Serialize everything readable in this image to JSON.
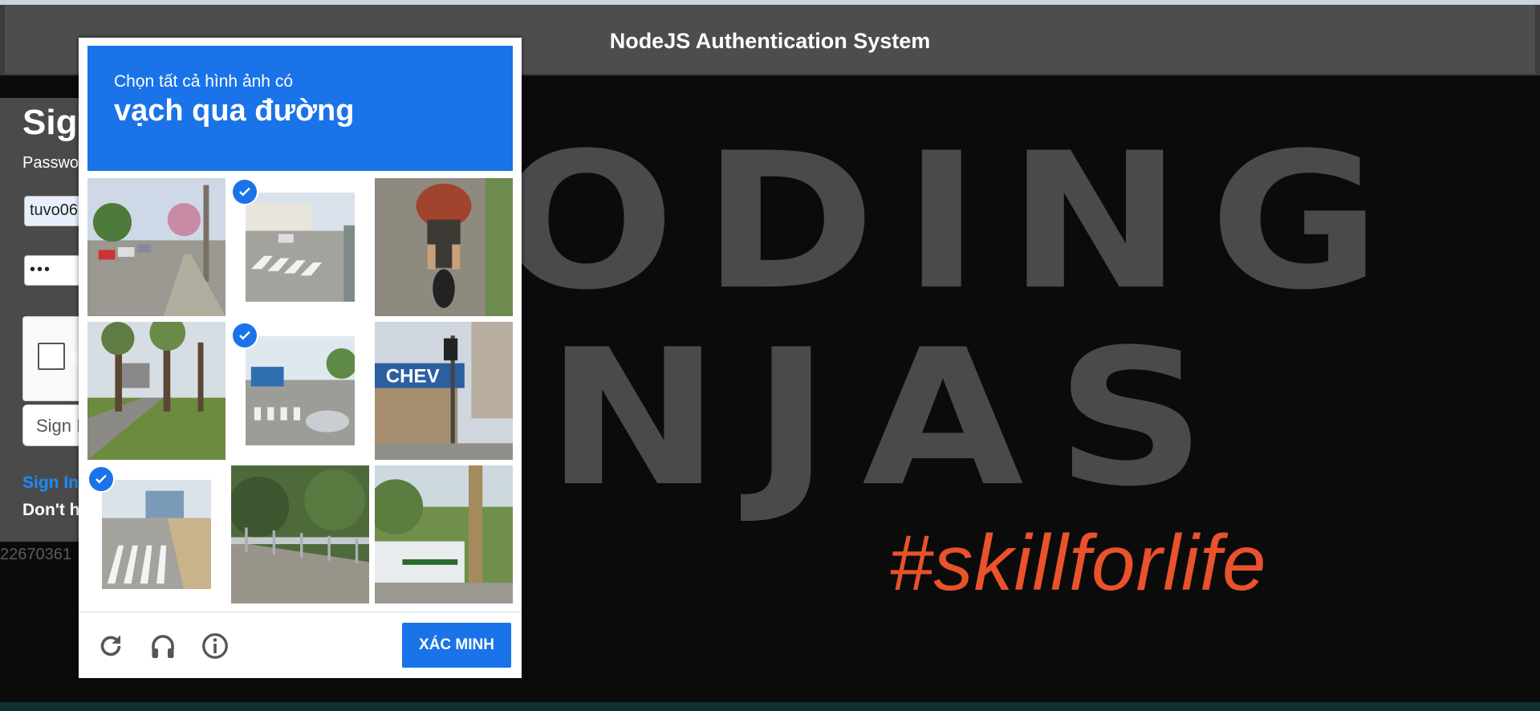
{
  "navbar": {
    "title": "NodeJS Authentication System"
  },
  "poster": {
    "line1": "ODING",
    "line2": "NJAS",
    "tagline": "#skillforlife",
    "tagline_color": "#e9522b"
  },
  "signin_card": {
    "title": "Sign",
    "password_label": "Passwo",
    "username_value": "tuvo06",
    "password_value": "•••",
    "signin_button": "Sign I",
    "signin_link": "Sign In",
    "dont_have_text": "Don't h",
    "bottom_id": "22670361"
  },
  "captcha": {
    "instruction": "Chọn tất cả hình ảnh có",
    "target": "vạch qua đường",
    "accent_color": "#1a73e8",
    "tiles": [
      {
        "name": "street-with-cars",
        "selected": false
      },
      {
        "name": "crosswalk-intersection",
        "selected": true
      },
      {
        "name": "motorcycle-rider",
        "selected": false
      },
      {
        "name": "tree-lined-path",
        "selected": false
      },
      {
        "name": "crosswalk-truck",
        "selected": true
      },
      {
        "name": "chevron-station",
        "selected": false
      },
      {
        "name": "crosswalk-sidewalk",
        "selected": true
      },
      {
        "name": "highway-railing",
        "selected": false
      },
      {
        "name": "car-pole",
        "selected": false
      }
    ],
    "footer": {
      "reload_icon": "reload-icon",
      "audio_icon": "headphones-icon",
      "info_icon": "info-icon",
      "verify_label": "XÁC MINH"
    }
  }
}
